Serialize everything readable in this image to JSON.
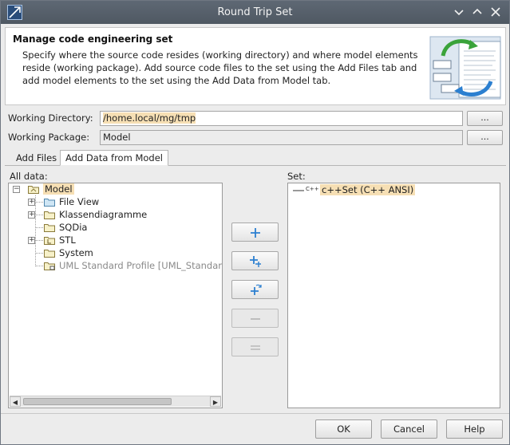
{
  "window": {
    "title": "Round Trip Set"
  },
  "header": {
    "title": "Manage code engineering set",
    "description": "Specify where the source code resides (working directory) and where model elements reside (working package). Add source code files to the set using the Add Files tab and add model elements to the set using the Add Data from Model tab."
  },
  "working_directory": {
    "label": "Working Directory:",
    "value": "/home.local/mg/tmp",
    "browse": "..."
  },
  "working_package": {
    "label": "Working Package:",
    "value": "Model",
    "browse": "..."
  },
  "tabs": [
    {
      "label": "Add Files"
    },
    {
      "label": "Add Data from Model"
    }
  ],
  "all_data": {
    "label": "All data:",
    "root": "Model",
    "items": [
      {
        "label": "File View"
      },
      {
        "label": "Klassendiagramme"
      },
      {
        "label": "SQDia"
      },
      {
        "label": "STL"
      },
      {
        "label": "System"
      },
      {
        "label": "UML Standard Profile [UML_Standard"
      }
    ]
  },
  "set": {
    "label": "Set:",
    "items": [
      {
        "badge": "C++",
        "label": "c++Set (C++ ANSI)"
      }
    ]
  },
  "buttons": {
    "ok": "OK",
    "cancel": "Cancel",
    "help": "Help"
  },
  "colors": {
    "titlebar": "#535c67",
    "selection": "#f6dfb4",
    "accent_blue": "#2b7fd0"
  }
}
